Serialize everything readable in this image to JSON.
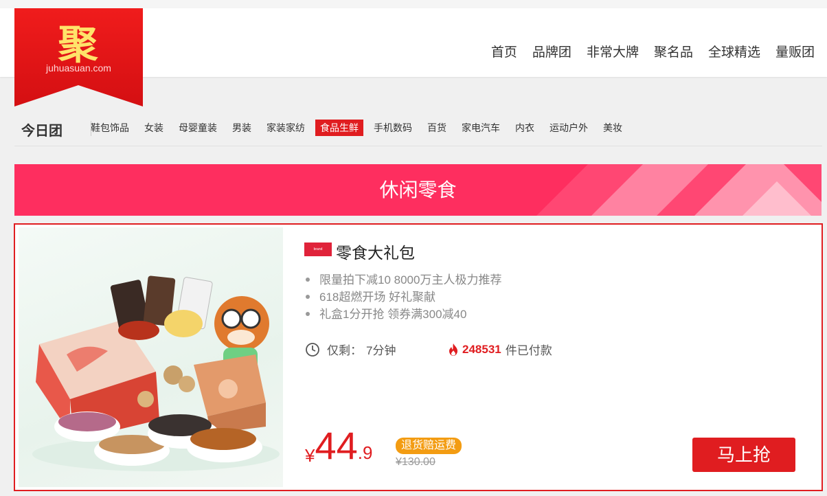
{
  "logo": {
    "char": "聚",
    "url": "juhuasuan.com"
  },
  "topnav": [
    "首页",
    "品牌团",
    "非常大牌",
    "聚名品",
    "全球精选",
    "量贩团"
  ],
  "category": {
    "title": "今日团",
    "items": [
      "鞋包饰品",
      "女装",
      "母婴童装",
      "男装",
      "家装家纺",
      "食品生鲜",
      "手机数码",
      "百货",
      "家电汽车",
      "内衣",
      "运动户外",
      "美妆"
    ],
    "active": "食品生鲜"
  },
  "banner": {
    "title": "休闲零食"
  },
  "product": {
    "title": "零食大礼包",
    "features": [
      "限量拍下减10 8000万主人极力推荐",
      "618超燃开场 好礼聚献",
      "礼盒1分开抢 领券满300减40"
    ],
    "remaining_label": "仅剩：",
    "remaining_value": "7分钟",
    "sold_count": "248531",
    "sold_suffix": "件已付款",
    "currency": "¥",
    "price_int": "44",
    "price_dec": ".9",
    "badge": "退货赔运费",
    "old_price": "¥130.00",
    "buy_label": "马上抢"
  },
  "colors": {
    "brand_red": "#e01d20",
    "banner_pink": "#fe2e5f",
    "badge_orange": "#f39c12"
  },
  "icons": [
    "clock-icon",
    "fire-icon"
  ]
}
